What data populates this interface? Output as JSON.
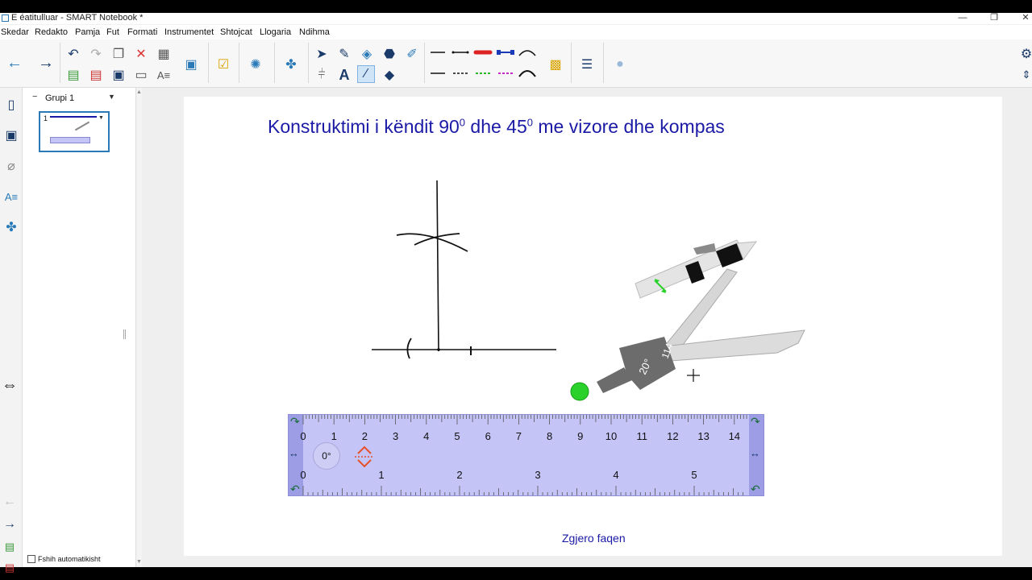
{
  "window": {
    "title": "E éatitulluar - SMART Notebook *",
    "min": "—",
    "max": "❐",
    "close": "✕"
  },
  "menu": [
    "Skedar",
    "Redakto",
    "Pamja",
    "Fut",
    "Formati",
    "Instrumentet",
    "Shtojcat",
    "Llogaria",
    "Ndihma"
  ],
  "sidepanel": {
    "group_label": "Grupi 1",
    "page_number": "1",
    "auto_hide_label": "Fshih automatikisht"
  },
  "page": {
    "title_part1": "Konstruktimi i këndit  90",
    "sup1": "0",
    "title_part2": "  dhe  45",
    "sup2": "0",
    "title_part3": "  me vizore dhe kompas",
    "expand_link": "Zgjero faqen"
  },
  "ruler": {
    "cm_labels": [
      "0",
      "1",
      "2",
      "3",
      "4",
      "5",
      "6",
      "7",
      "8",
      "9",
      "10",
      "11",
      "12",
      "13",
      "14"
    ],
    "inch_labels": [
      "0",
      "1",
      "2",
      "3",
      "4",
      "5"
    ],
    "angle_label": "0°"
  },
  "compass": {
    "angle_label": "20°",
    "radius_label": "114"
  },
  "colors": {
    "title": "#1a1aa6",
    "ruler_fill": "#c4c4f7",
    "accent": "#2a7ab8"
  }
}
